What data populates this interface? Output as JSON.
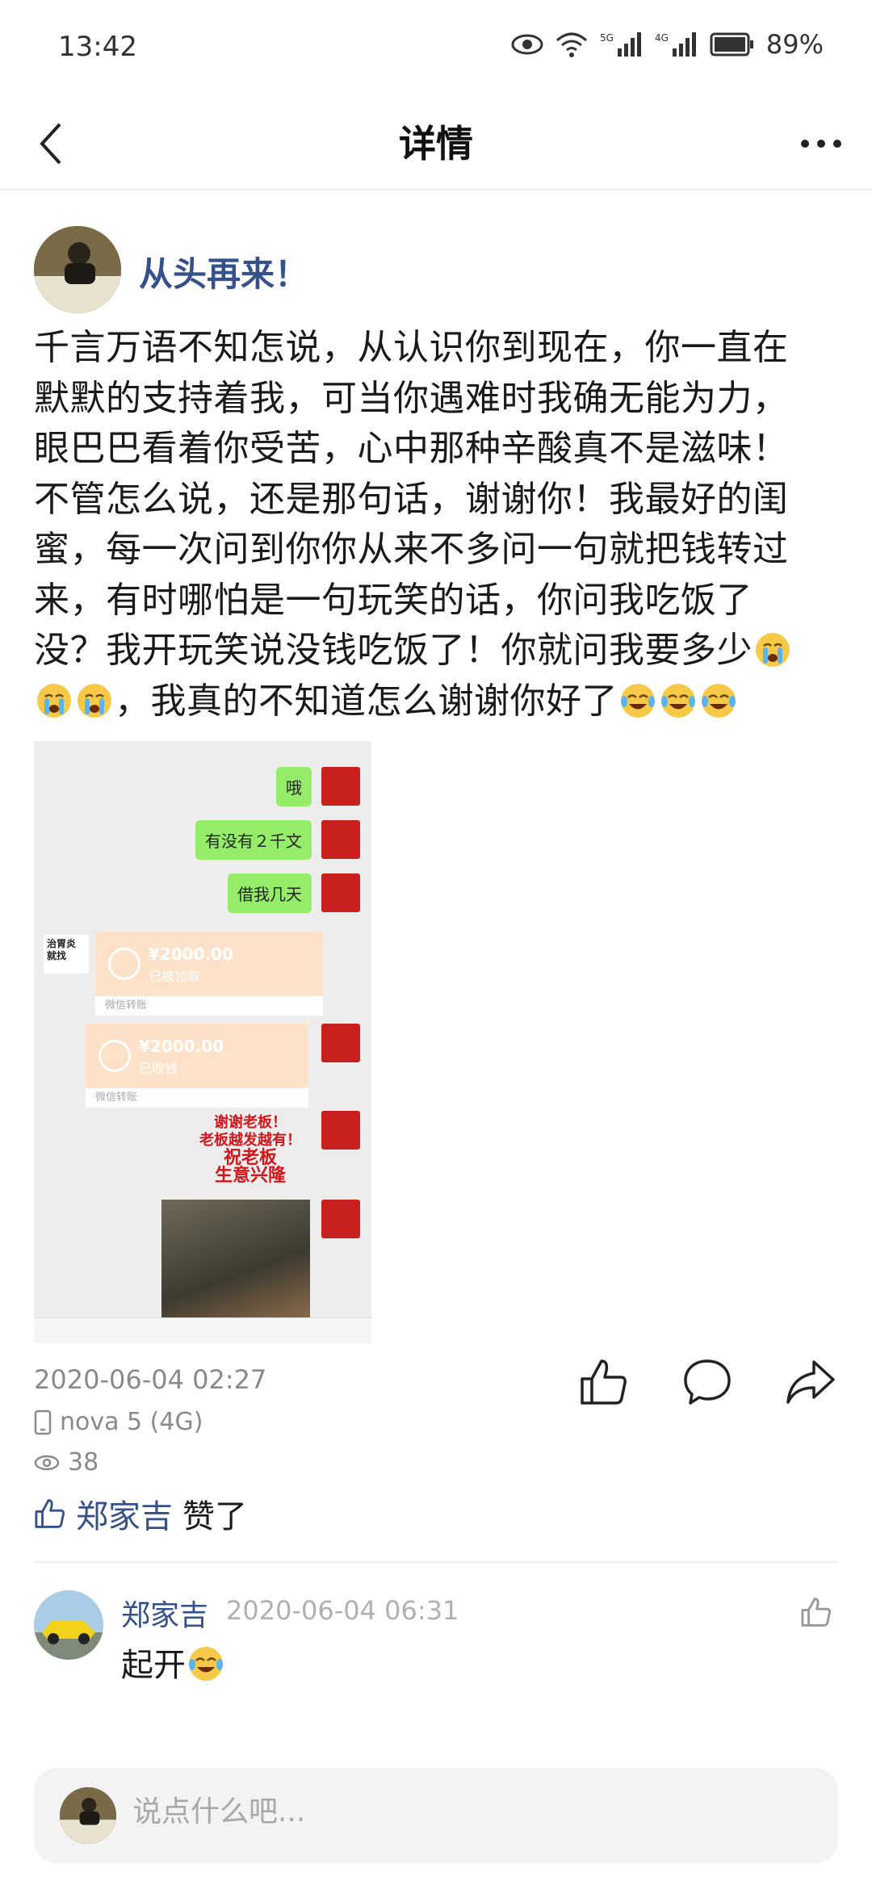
{
  "status_bar": {
    "time": "13:42",
    "battery": "89%"
  },
  "nav": {
    "title": "详情"
  },
  "author": {
    "name": "从头再来！"
  },
  "post": {
    "lines": [
      "千言万语不知怎说，从认识你到现在，你一直在",
      "默默的支持着我，可当你遇难时我确无能为力，",
      "眼巴巴看着你受苦，心中那种辛酸真不是滋味！",
      "不管怎么说，还是那句话，谢谢你！我最好的闺",
      "蜜，每一次问到你你从来不多问一句就把钱转过",
      "来，有时哪怕是一句玩笑的话，你问我吃饭了",
      "没？我开玩笑说没钱吃饭了！你就问我要多少",
      "，我真的不知道怎么谢谢你好了"
    ],
    "image": {
      "messages": [
        "哦",
        "有没有２千文",
        "借我几天"
      ],
      "transfers": [
        {
          "amount": "¥2000.00",
          "status": "已被领取",
          "footer": "微信转账"
        },
        {
          "amount": "¥2000.00",
          "status": "已收钱",
          "footer": "微信转账"
        }
      ],
      "sticker": [
        "谢谢老板！",
        "老板越发越有！",
        "祝老板",
        "生意兴隆"
      ],
      "side_sticker": "治胃炎 就找"
    }
  },
  "meta": {
    "time": "2020-06-04 02:27",
    "device": "nova 5 (4G)",
    "views": "38"
  },
  "likes": {
    "user": "郑家吉",
    "suffix": "赞了"
  },
  "comment": {
    "user": "郑家吉",
    "time": "2020-06-04 06:31",
    "text": "起开"
  },
  "input": {
    "placeholder": "说点什么吧..."
  },
  "colors": {
    "link_blue": "#34518a",
    "meta_gray": "#8a8a8a"
  },
  "icons": [
    "back-icon",
    "more-icon",
    "like-icon",
    "comment-icon",
    "share-icon",
    "phone-icon",
    "eye-icon"
  ]
}
